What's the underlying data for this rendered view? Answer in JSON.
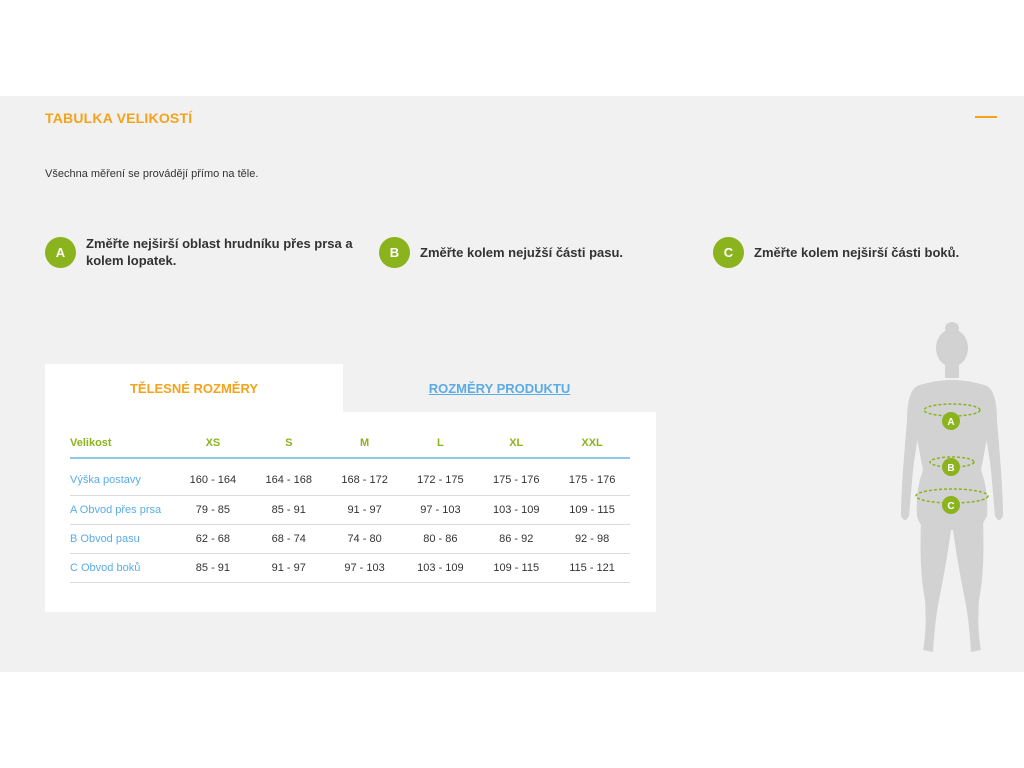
{
  "panel": {
    "title": "TABULKA VELIKOSTÍ",
    "intro": "Všechna měření se provádějí přímo na těle."
  },
  "steps": [
    {
      "badge": "A",
      "text": "Změřte nejširší oblast hrudníku přes prsa a kolem lopatek."
    },
    {
      "badge": "B",
      "text": "Změřte kolem nejužší části pasu."
    },
    {
      "badge": "C",
      "text": "Změřte kolem nejširší části boků."
    }
  ],
  "tabs": [
    {
      "label": "TĚLESNÉ ROZMĚRY",
      "active": true
    },
    {
      "label": "ROZMĚRY PRODUKTU",
      "active": false
    }
  ],
  "table": {
    "headers": [
      "Velikost",
      "XS",
      "S",
      "M",
      "L",
      "XL",
      "XXL"
    ],
    "rows": [
      {
        "label": "Výška postavy",
        "values": [
          "160 - 164",
          "164 - 168",
          "168 - 172",
          "172 - 175",
          "175 - 176",
          "175 - 176"
        ]
      },
      {
        "label": "A Obvod přes prsa",
        "values": [
          "79 - 85",
          "85 - 91",
          "91 - 97",
          "97 - 103",
          "103 - 109",
          "109 - 115"
        ]
      },
      {
        "label": "B Obvod pasu",
        "values": [
          "62 - 68",
          "68 - 74",
          "74 - 80",
          "80 - 86",
          "86 - 92",
          "92 - 98"
        ]
      },
      {
        "label": "C Obvod boků",
        "values": [
          "85 - 91",
          "91 - 97",
          "97 - 103",
          "103 - 109",
          "109 - 115",
          "115 - 121"
        ]
      }
    ]
  },
  "figure": {
    "markers": [
      "A",
      "B",
      "C"
    ]
  },
  "colors": {
    "accent_orange": "#f5a31a",
    "badge_green": "#8bb31d",
    "link_blue": "#5aace6",
    "panel_bg": "#f1f1f1"
  }
}
